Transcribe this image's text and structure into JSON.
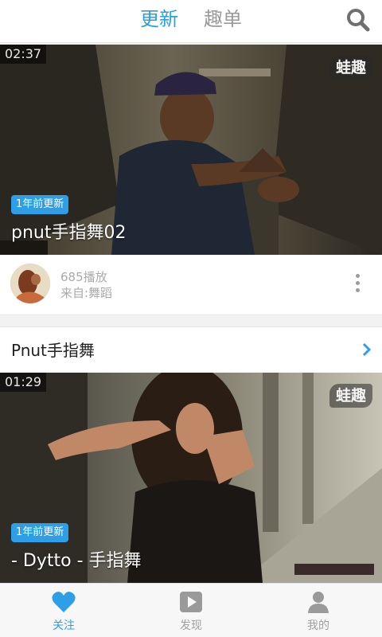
{
  "header": {
    "tabs": [
      {
        "label": "更新",
        "active": true
      },
      {
        "label": "趣单",
        "active": false
      }
    ],
    "search_icon": "search-icon"
  },
  "videos": [
    {
      "duration": "02:37",
      "watermark": "蛙趣",
      "badge": "1年前更新",
      "title": "pnut手指舞02"
    },
    {
      "duration": "01:29",
      "watermark": "蛙趣",
      "badge": "1年前更新",
      "title": "- Dytto - 手指舞"
    }
  ],
  "info_row": {
    "plays": "685播放",
    "source": "来自:舞蹈",
    "more_icon": "more-vertical-icon"
  },
  "section": {
    "title": "Pnut手指舞",
    "chevron_icon": "chevron-right-icon"
  },
  "bottom_nav": [
    {
      "label": "关注",
      "icon": "heart-icon",
      "active": true
    },
    {
      "label": "发现",
      "icon": "play-icon",
      "active": false
    },
    {
      "label": "我的",
      "icon": "user-icon",
      "active": false
    }
  ],
  "colors": {
    "accent": "#2e9fe6",
    "inactive": "#a0a0a0"
  }
}
